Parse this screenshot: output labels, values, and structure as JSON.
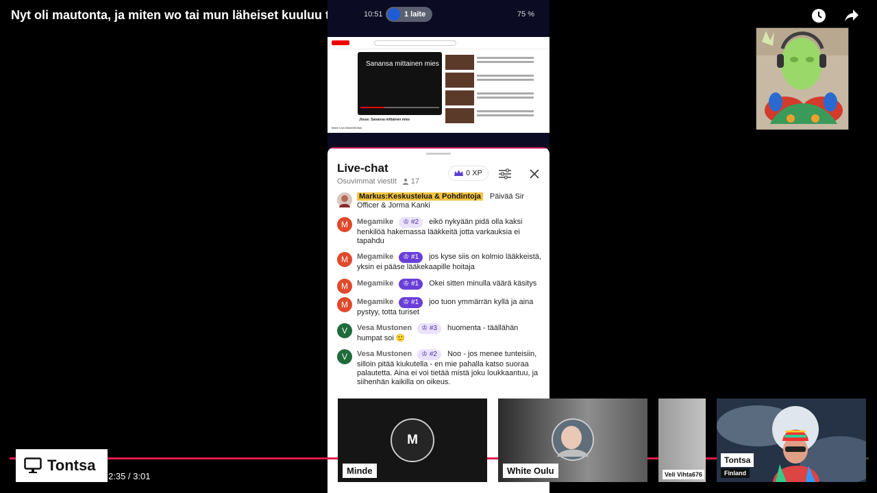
{
  "title": "Nyt oli mautonta, ja miten wo tai mun läheiset kuuluu tänne",
  "phone_status": {
    "time": "10:51",
    "pill": "1 laite",
    "battery": "75 %"
  },
  "mini_youtube": {
    "player_title": "Sanansa mittainen mies",
    "caption": "Jösse: Sanansa mittainen mies",
    "channel": "Mabe Live/Jösse/Medias"
  },
  "chat": {
    "title": "Live-chat",
    "filter": "Osuvimmat viestit",
    "viewers": "17",
    "xp": "0 XP",
    "messages": [
      {
        "initial": "",
        "name": "Markus:Keskustelua & Pohdintoja",
        "rank": "",
        "text": "Päivää Sir Officer & Jorma Kanki"
      },
      {
        "initial": "M",
        "name": "Megamike",
        "rank": "#2",
        "text": "eikö nykyään pidä olla kaksi henkilöä hakemassa lääkkeitä jotta varkauksia ei tapahdu"
      },
      {
        "initial": "M",
        "name": "Megamike",
        "rank": "#1",
        "text": "jos kyse siis on kolmio lääkkeistä, yksin ei pääse lääkekaapille hoitaja"
      },
      {
        "initial": "M",
        "name": "Megamike",
        "rank": "#1",
        "text": "Okei sitten minulla väärä käsitys"
      },
      {
        "initial": "M",
        "name": "Megamike",
        "rank": "#1",
        "text": "joo tuon ymmärrän kyllä ja aina pystyy, totta turiset"
      },
      {
        "initial": "V",
        "name": "Vesa Mustonen",
        "rank": "#3",
        "text": "huomenta - täällähän humpat soi 🙂"
      },
      {
        "initial": "V",
        "name": "Vesa Mustonen",
        "rank": "#2",
        "text": "Noo - jos menee tunteisiin, silloin pitää kiukutella - en mie pahalla katso suoraa palautetta. Aina ei voi tietää mistä joku loukkaantuu, ja siihenhän kaikilla on oikeus."
      }
    ]
  },
  "participants": [
    {
      "name": "Minde",
      "initial": "M"
    },
    {
      "name": "White Oulu"
    },
    {
      "name": "Veli Vihta676"
    },
    {
      "name": "Tontsa",
      "location": "Finland"
    }
  ],
  "player": {
    "time": "2:35 / 3:01",
    "host": "Tontsa",
    "progress": 0.86
  },
  "colors": {
    "accent": "#e01b4c",
    "rank_primary": "#6a3fd8",
    "highlight": "#f4c542",
    "avatar_megamike": "#e0492b",
    "avatar_vesa": "#1f6b3a"
  }
}
